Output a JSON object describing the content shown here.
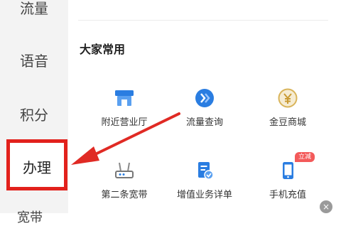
{
  "sidebar": {
    "items": [
      {
        "label": "流量"
      },
      {
        "label": "语音"
      },
      {
        "label": "积分"
      },
      {
        "label": "办理"
      },
      {
        "label": "宽带"
      }
    ]
  },
  "section": {
    "title": "大家常用"
  },
  "grid": {
    "items": [
      {
        "label": "附近营业厅",
        "icon": "store-icon"
      },
      {
        "label": "流量查询",
        "icon": "data-query-icon"
      },
      {
        "label": "金豆商城",
        "icon": "coin-mall-icon"
      },
      {
        "label": "第二条宽带",
        "icon": "router-icon"
      },
      {
        "label": "增值业务详单",
        "icon": "document-check-icon"
      },
      {
        "label": "手机充值",
        "icon": "phone-topup-icon"
      }
    ],
    "badge": "立减"
  },
  "close": {
    "symbol": "×"
  },
  "colors": {
    "accent": "#2a7de1",
    "highlight": "#e2211c",
    "arrow": "#e02a24",
    "coin": "#d9b45a"
  }
}
